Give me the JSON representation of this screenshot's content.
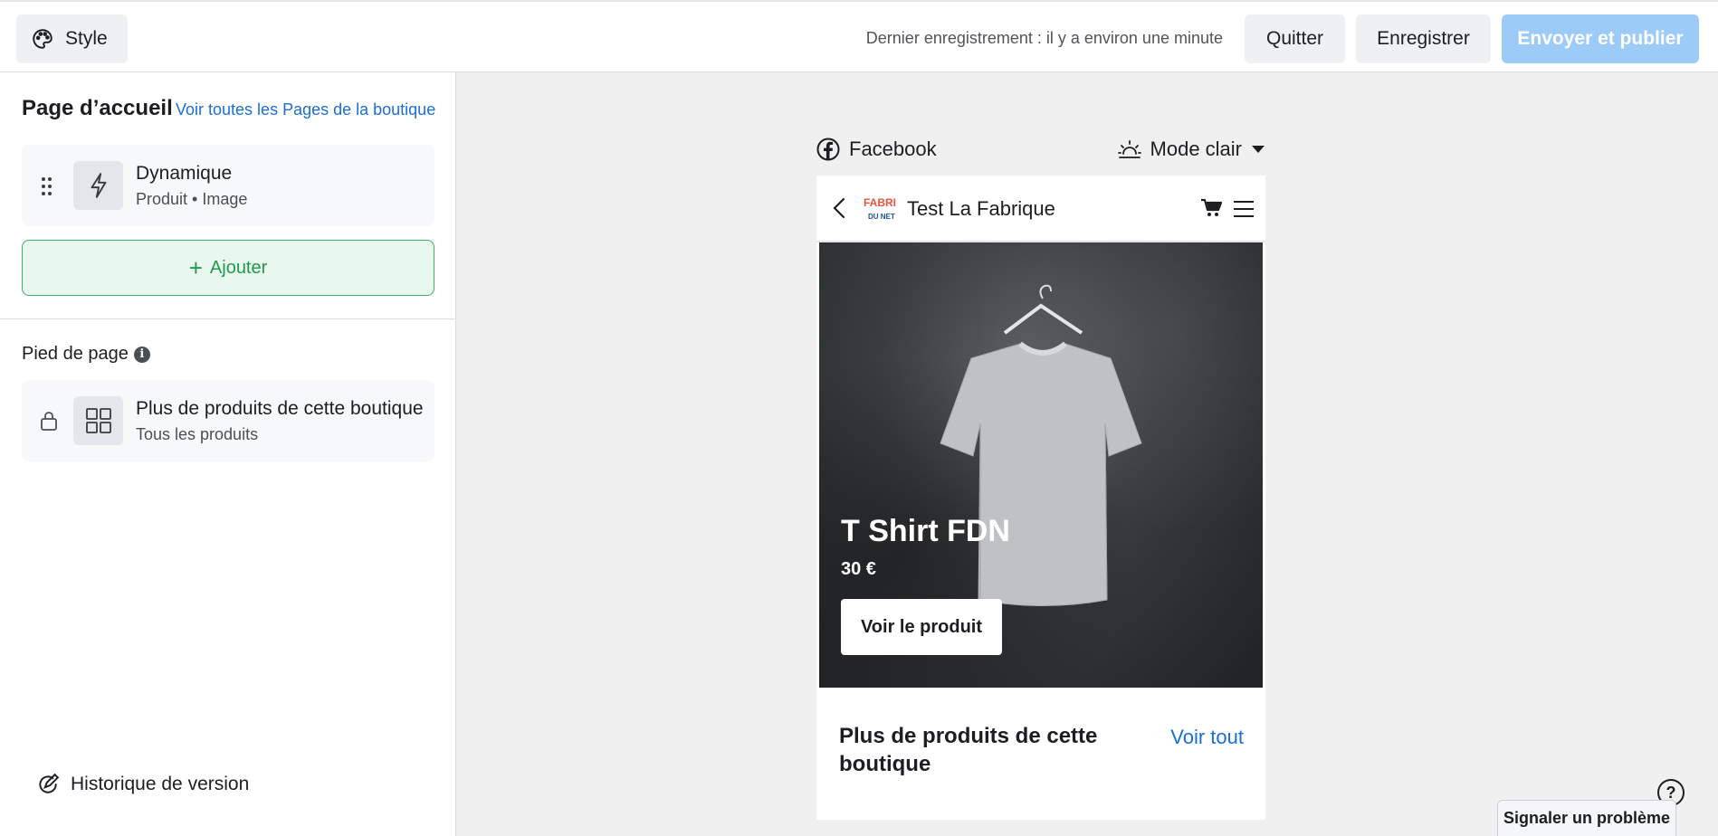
{
  "topbar": {
    "style_label": "Style",
    "last_saved": "Dernier enregistrement : il y a environ une minute",
    "quit_label": "Quitter",
    "save_label": "Enregistrer",
    "publish_label": "Envoyer et publier"
  },
  "sidebar": {
    "home_title": "Page d’accueil",
    "see_all_pages": "Voir toutes les Pages de la boutique",
    "sections": [
      {
        "title": "Dynamique",
        "subtitle": "Produit • Image",
        "icon": "lightning-icon"
      }
    ],
    "add_label": "Ajouter",
    "footer_title": "Pied de page",
    "footer_sections": [
      {
        "title": "Plus de produits de cette boutique",
        "subtitle": "Tous les produits",
        "icon": "grid-icon"
      }
    ],
    "history_label": "Historique de version"
  },
  "preview": {
    "platform": "Facebook",
    "mode": "Mode clair",
    "shop_name": "Test La Fabrique",
    "logo_text_top": "FABRI",
    "logo_text_bottom": "DU NET",
    "hero": {
      "title": "T Shirt FDN",
      "price": "30 €",
      "button": "Voir le produit"
    },
    "more_title": "Plus de produits de cette boutique",
    "see_all": "Voir tout"
  },
  "help_label": "?",
  "report_label": "Signaler un problème",
  "colors": {
    "accent_blue": "#1a6ed8",
    "publish_disabled": "#9dcbf8",
    "add_green": "#1e9a4a"
  }
}
